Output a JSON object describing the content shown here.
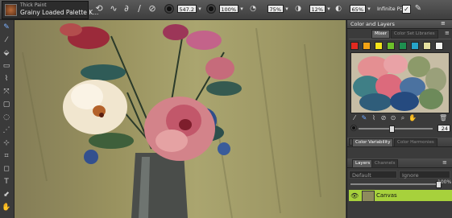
{
  "toolbar": {
    "brush_category": "Thick Paint",
    "brush_variant": "Grainy Loaded Palette K...",
    "size_value": "547.2",
    "opacity_value": "100%",
    "resat_value": "75%",
    "bleed_value": "12%",
    "jitter_value": "65%",
    "infinite_paint_label": "Infinite Paint",
    "infinite_paint_checked": "✓"
  },
  "color_panel": {
    "title": "Color and Layers",
    "tabs": [
      "Mixer",
      "Color Set Libraries"
    ],
    "swatches": [
      "#e02a20",
      "#f2a215",
      "#f3e31b",
      "#6cbf2a",
      "#1e8f4f",
      "#27a4c8",
      "#e5e0a0",
      "#f3f3f0"
    ],
    "brush_size_value": "24"
  },
  "color_variability": {
    "tabs": [
      "Color Variability",
      "Color Harmonies"
    ]
  },
  "layers_panel": {
    "tabs": [
      "Layers",
      "Channels"
    ],
    "composite_method": "Default",
    "preserve_option": "Ignore",
    "opacity_value": "100%",
    "layer_name": "Canvas"
  }
}
